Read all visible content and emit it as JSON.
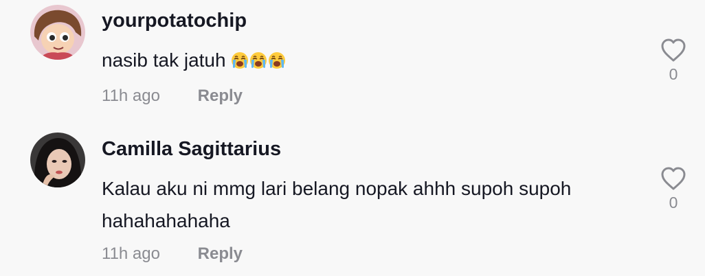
{
  "comments": [
    {
      "username": "yourpotatochip",
      "text": "nasib tak jatuh",
      "emojis": [
        "loudly-crying-face",
        "loudly-crying-face",
        "loudly-crying-face"
      ],
      "time": "11h ago",
      "reply_label": "Reply",
      "like_count": "0"
    },
    {
      "username": "Camilla Sagittarius",
      "text": "Kalau aku ni mmg lari belang nopak ahhh supoh supoh hahahahahaha",
      "time": "11h ago",
      "reply_label": "Reply",
      "like_count": "0"
    }
  ],
  "icons": {
    "like": "heart-outline-icon"
  },
  "colors": {
    "background": "#f8f8f8",
    "text": "#161823",
    "muted": "#8a8b91"
  }
}
